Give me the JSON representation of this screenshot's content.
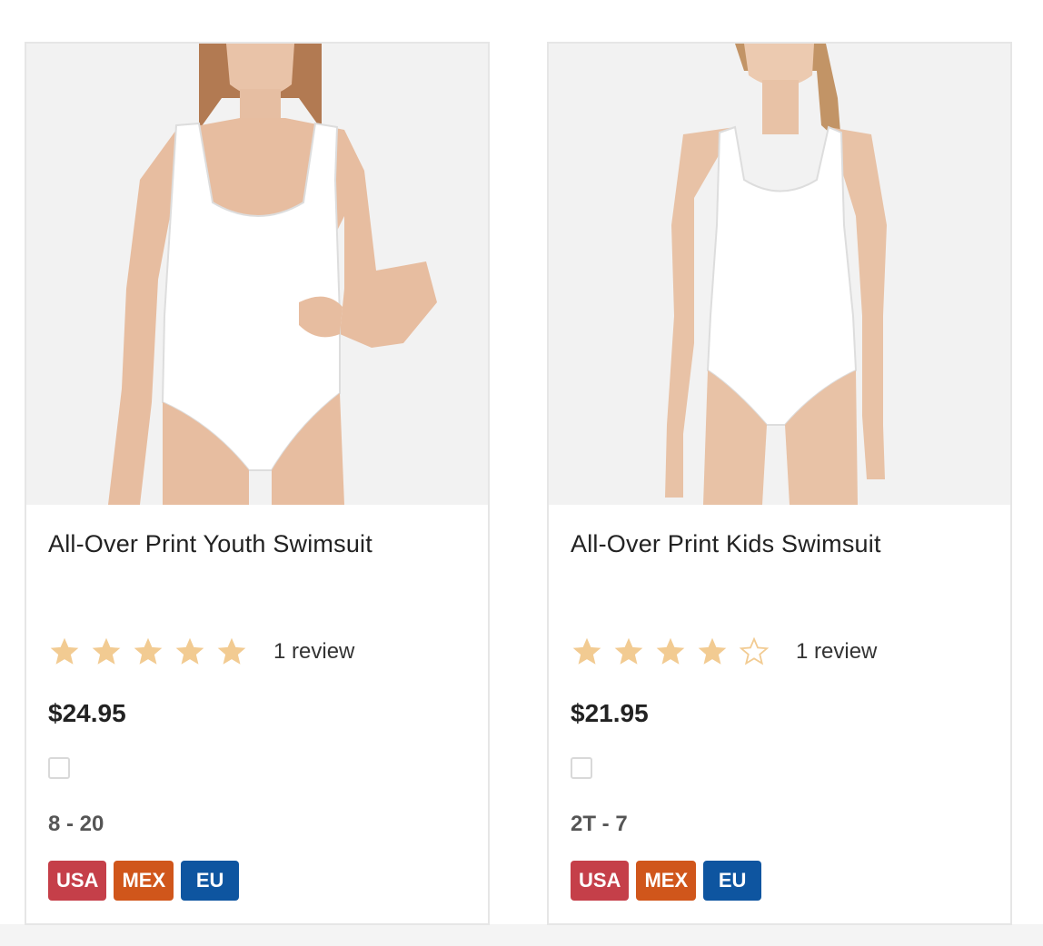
{
  "products": [
    {
      "image_alt": "All-Over Print Youth Swimsuit",
      "title": "All-Over Print Youth Swimsuit",
      "rating": 5,
      "reviews": "1 review",
      "price": "$24.95",
      "sizes": "8 - 20",
      "regions": [
        "USA",
        "MEX",
        "EU"
      ]
    },
    {
      "image_alt": "All-Over Print Kids Swimsuit",
      "title": "All-Over Print Kids Swimsuit",
      "rating": 4,
      "reviews": "1 review",
      "price": "$21.95",
      "sizes": "2T - 7",
      "regions": [
        "USA",
        "MEX",
        "EU"
      ]
    }
  ],
  "colors": {
    "star_filled": "#f2cb92",
    "star_empty_outline": "#f2cb92",
    "region_usa": "#c53f49",
    "region_mex": "#d0561b",
    "region_eu": "#0e55a0",
    "card_border": "#e6e6e6"
  },
  "icons": {
    "star_filled": "star-filled-icon",
    "star_empty": "star-empty-icon",
    "checkbox": "compare-checkbox"
  }
}
